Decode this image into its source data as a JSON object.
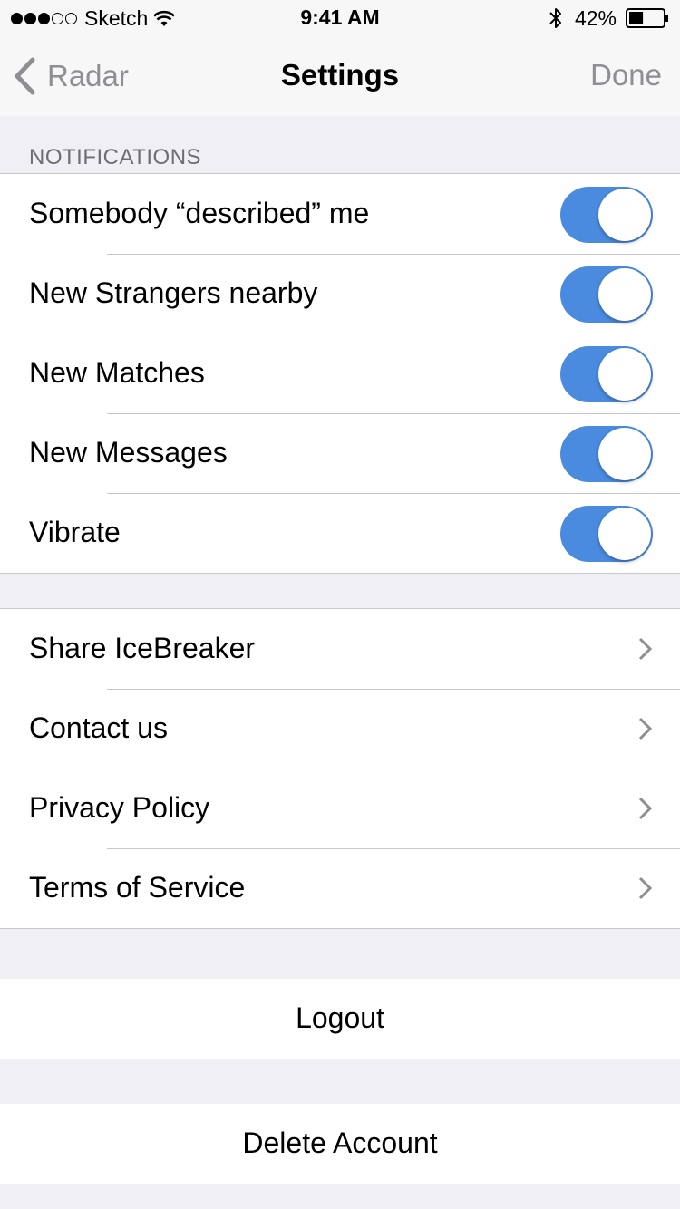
{
  "status_bar": {
    "signal_filled": 3,
    "signal_total": 5,
    "carrier": "Sketch",
    "wifi_icon": "wifi-icon",
    "time": "9:41 AM",
    "bluetooth_icon": "bluetooth-icon",
    "battery_percent": "42%",
    "battery_level": 0.42
  },
  "nav": {
    "back_label": "Radar",
    "title": "Settings",
    "done_label": "Done"
  },
  "notifications": {
    "header": "NOTIFICATIONS",
    "items": [
      {
        "label": "Somebody “described” me",
        "on": true
      },
      {
        "label": "New Strangers nearby",
        "on": true
      },
      {
        "label": "New Matches",
        "on": true
      },
      {
        "label": "New Messages",
        "on": true
      },
      {
        "label": "Vibrate",
        "on": true
      }
    ]
  },
  "links": {
    "items": [
      {
        "label": "Share IceBreaker"
      },
      {
        "label": "Contact us"
      },
      {
        "label": "Privacy Policy"
      },
      {
        "label": "Terms of Service"
      }
    ]
  },
  "actions": {
    "logout_label": "Logout",
    "delete_label": "Delete Account"
  },
  "colors": {
    "toggle_on": "#4a8be0",
    "secondary_text": "#8e8e93",
    "background": "#efeff4"
  }
}
